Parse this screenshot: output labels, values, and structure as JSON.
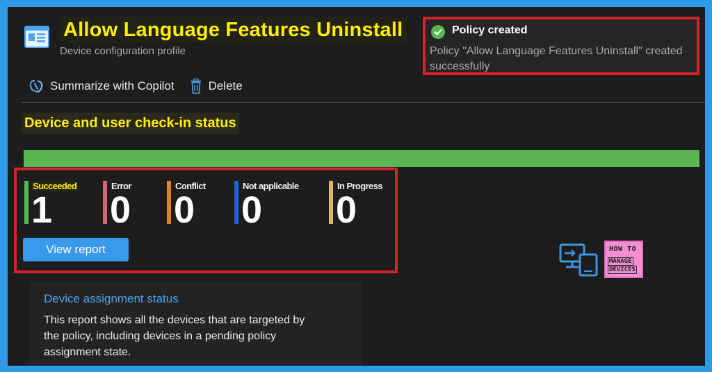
{
  "header": {
    "title": "Allow Language Features Uninstall",
    "subtitle": "Device configuration profile",
    "icon": "profile-icon"
  },
  "toast": {
    "title": "Policy created",
    "message": "Policy \"Allow Language Features Uninstall\" created successfully",
    "icon": "check-circle-icon",
    "color": "#5ab552"
  },
  "toolbar": {
    "copilot_label": "Summarize with Copilot",
    "delete_label": "Delete"
  },
  "checkin": {
    "title": "Device and user check-in status",
    "progress_succeeded_fraction": 1.0,
    "stats": [
      {
        "label": "Succeeded",
        "value": "1",
        "color": "#5ab552"
      },
      {
        "label": "Error",
        "value": "0",
        "color": "#e0606c"
      },
      {
        "label": "Conflict",
        "value": "0",
        "color": "#ea7a2e"
      },
      {
        "label": "Not applicable",
        "value": "0",
        "color": "#1f63d8"
      },
      {
        "label": "In Progress",
        "value": "0",
        "color": "#d8b95a"
      }
    ],
    "view_report_label": "View report"
  },
  "logo": {
    "line1": "HOW TO",
    "line2": "MANAGE",
    "line3": "DEVICES"
  },
  "assignment_card": {
    "link": "Device assignment status",
    "description": "This report shows all the devices that are targeted by the policy, including devices in a pending policy assignment state."
  },
  "colors": {
    "highlight": "#ffee00",
    "accent_blue": "#3999ea",
    "annotation_red": "#d8202a"
  }
}
